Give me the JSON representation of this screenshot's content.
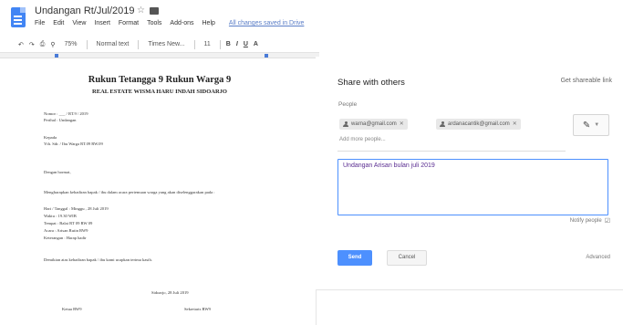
{
  "app": {
    "title": "Undangan Rt/Jul/2019",
    "last_edit": "All changes saved in Drive",
    "menus": [
      "File",
      "Edit",
      "View",
      "Insert",
      "Format",
      "Tools",
      "Add-ons",
      "Help"
    ]
  },
  "toolbar": {
    "zoom": "75%",
    "style": "Normal text",
    "font": "Times New...",
    "size": "11",
    "bold": "B",
    "italic": "I",
    "underline": "U",
    "text_color": "A"
  },
  "document": {
    "title": "Rukun Tetangga 9 Rukun Warga 9",
    "subtitle": "REAL ESTATE WISMA HARU INDAH SIDOARJO",
    "lines": [
      "Nomor       : ___ / RT.9 / 2019",
      "Perihal     : Undangan",
      "Kepada",
      "Yth.  Sdr. / Ibu Warga RT.09 RW.09",
      "Dengan hormat,",
      "Mengharapkan kehadiran bapak / ibu dalam acara pertemuan warga yang akan diselenggarakan pada :",
      "Hari / Tanggal   : Minggu , 28 Juli 2019",
      "Waktu              : 19.30 WIB",
      "Tempat             : Balai RT 09 RW 09",
      "Acara               : Arisan Rutin RW9",
      "Keterangan       : Harap hadir",
      "Demikian atas kehadiran bapak / ibu kami ucapkan terima kasih.",
      "Sidoarjo, 28 Juli 2019",
      "Ketua RW9",
      "Sekretaris RW9"
    ]
  },
  "share": {
    "title": "Share with others",
    "shareable_link": "Get shareable link",
    "people_label": "People",
    "recipients": [
      "warna@gmail.com",
      "ardanacantik@gmail.com"
    ],
    "add_more": "Add more people...",
    "message": "Undangan Arisan bulan juli 2019",
    "notify_label": "Notify people",
    "send_label": "Send",
    "cancel_label": "Cancel",
    "advanced_label": "Advanced"
  }
}
